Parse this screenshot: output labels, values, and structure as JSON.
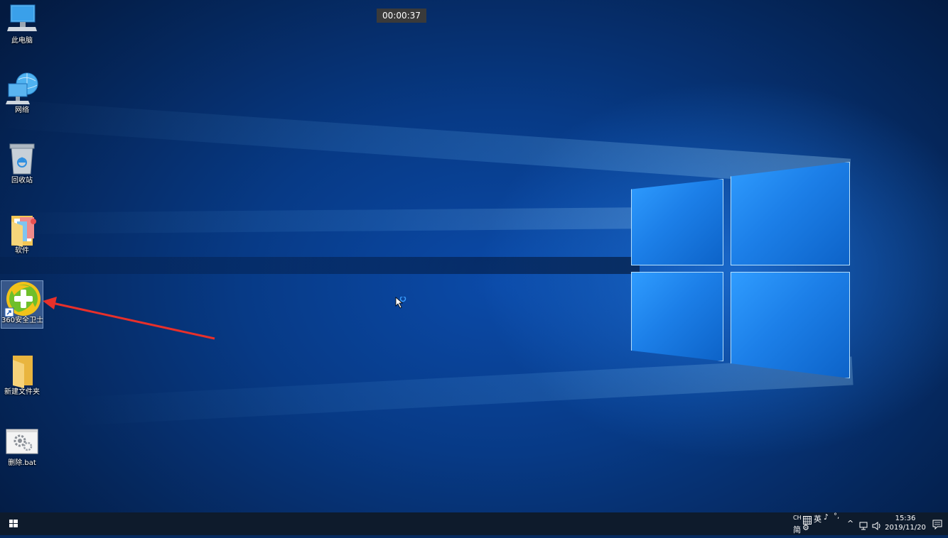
{
  "desktop": {
    "icons": [
      {
        "label": "此电脑",
        "icon": "computer-icon"
      },
      {
        "label": "网络",
        "icon": "network-icon"
      },
      {
        "label": "回收站",
        "icon": "recycle-bin-icon"
      },
      {
        "label": "软件",
        "icon": "folder-icon"
      },
      {
        "label": "360安全卫士",
        "icon": "360-security-icon",
        "selected": true
      },
      {
        "label": "新建文件夹",
        "icon": "folder-icon"
      },
      {
        "label": "删除.bat",
        "icon": "batch-file-icon"
      }
    ],
    "annotation_color": "#e8302a"
  },
  "overlay": {
    "timer": "00:00:37"
  },
  "taskbar": {
    "start_icon": "windows-logo-icon",
    "tray": {
      "ime_ch": "CH",
      "ime_en": "英",
      "ime_simplified": "简",
      "time": "15:36",
      "date": "2019/11/20"
    }
  }
}
